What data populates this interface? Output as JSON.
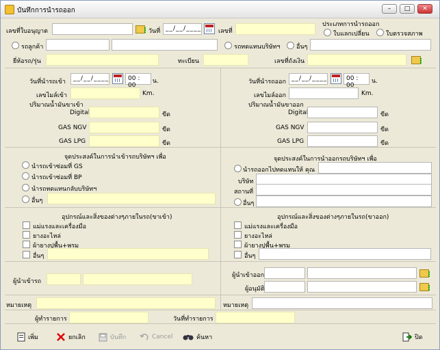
{
  "window": {
    "title": "บันทึกการนำรถออก"
  },
  "top": {
    "license_label": "เลขที่ใบอนุญาต",
    "date_label": "วันที่",
    "date_value": "__/__/____",
    "number_label": "เลขที่",
    "type_label": "ประเภทการนำรถออก",
    "type_option1": "ใบแลกเปลี่ยน",
    "type_option2": "ใบตรวจสภาพ",
    "customer_car_label": "รถลูกค้า",
    "company_car_label": "รถทดแทนบริษัทฯ",
    "other_label": "อื่นๆ",
    "brand_label": "ยี่ห้อรถ/รุ่น",
    "plate_label": "ทะเบียน",
    "chassis_label": "เลขที่ถังเงิน"
  },
  "in": {
    "date_label": "วันที่นำรถเข้า",
    "date_value": "__/__/____",
    "hour": "00",
    "minute": "00",
    "time_unit": "น.",
    "mileage_label": "เลขไมล์เข้า",
    "km_unit": "Km.",
    "fuel_label": "ปริมาณน้ำมันขาเข้า",
    "fuel_rows": [
      "Digital",
      "GAS NGV",
      "GAS LPG"
    ],
    "fuel_unit": "ขีด",
    "purpose_title": "จุดประสงค์ในการนำเข้ารถบริษัทฯ เพื่อ",
    "purpose_options": [
      "นำรถเข้าซ่อมที่ GS",
      "นำรถเข้าซ่อมที่ BP",
      "นำรถทดแทนกลับบริษัทฯ",
      "อื่นๆ"
    ],
    "equip_title": "อุปกรณ์และสิ่งของต่างๆภายในรถ(ขาเข้า)",
    "equip_items": [
      "แม่แรงและเครื่องมือ",
      "ยางอะไหล่",
      "ผ้ายางปูพื้น+พรม",
      "อื่นๆ"
    ],
    "driver_label": "ผู้นำเข้ารถ",
    "remark_label": "หมายเหตุ"
  },
  "out": {
    "date_label": "วันที่นำรถออก",
    "date_value": "__/__/____",
    "hour": "00",
    "minute": "00",
    "time_unit": "น.",
    "mileage_label": "เลขไมล์ออก",
    "km_unit": "Km.",
    "fuel_label": "ปริมาณน้ำมันขาออก",
    "fuel_rows": [
      "Digital",
      "GAS NGV",
      "GAS LPG"
    ],
    "fuel_unit": "ขีด",
    "purpose_title": "จุดประสงค์ในการนำออกรถบริษัทฯ เพื่อ",
    "purpose_option1": "นำรถออกไปทดแทนให้ คุณ",
    "company_label": "บริษัท",
    "place_label": "สถานที่",
    "other_label": "อื่นๆ",
    "equip_title": "อุปกรณ์และสิ่งของต่างๆภายในรถ(ขาออก)",
    "equip_items": [
      "แม่แรงและเครื่องมือ",
      "ยางอะไหล่",
      "ผ้ายางปูพื้น+พรม",
      "อื่นๆ"
    ],
    "driver_label": "ผู้นำเข้าออก",
    "approver_label": "ผู้อนุมัติ",
    "remark_label": "หมายเหตุ"
  },
  "footer": {
    "operator_label": "ผู้ทำรายการ",
    "op_date_label": "วันที่ทำรายการ"
  },
  "toolbar": {
    "add": "เพิ่ม",
    "cancel_th": "ยกเลิก",
    "save": "บันทึก",
    "cancel_en": "Cancel",
    "search": "ค้นหา",
    "close": "ปิด"
  }
}
